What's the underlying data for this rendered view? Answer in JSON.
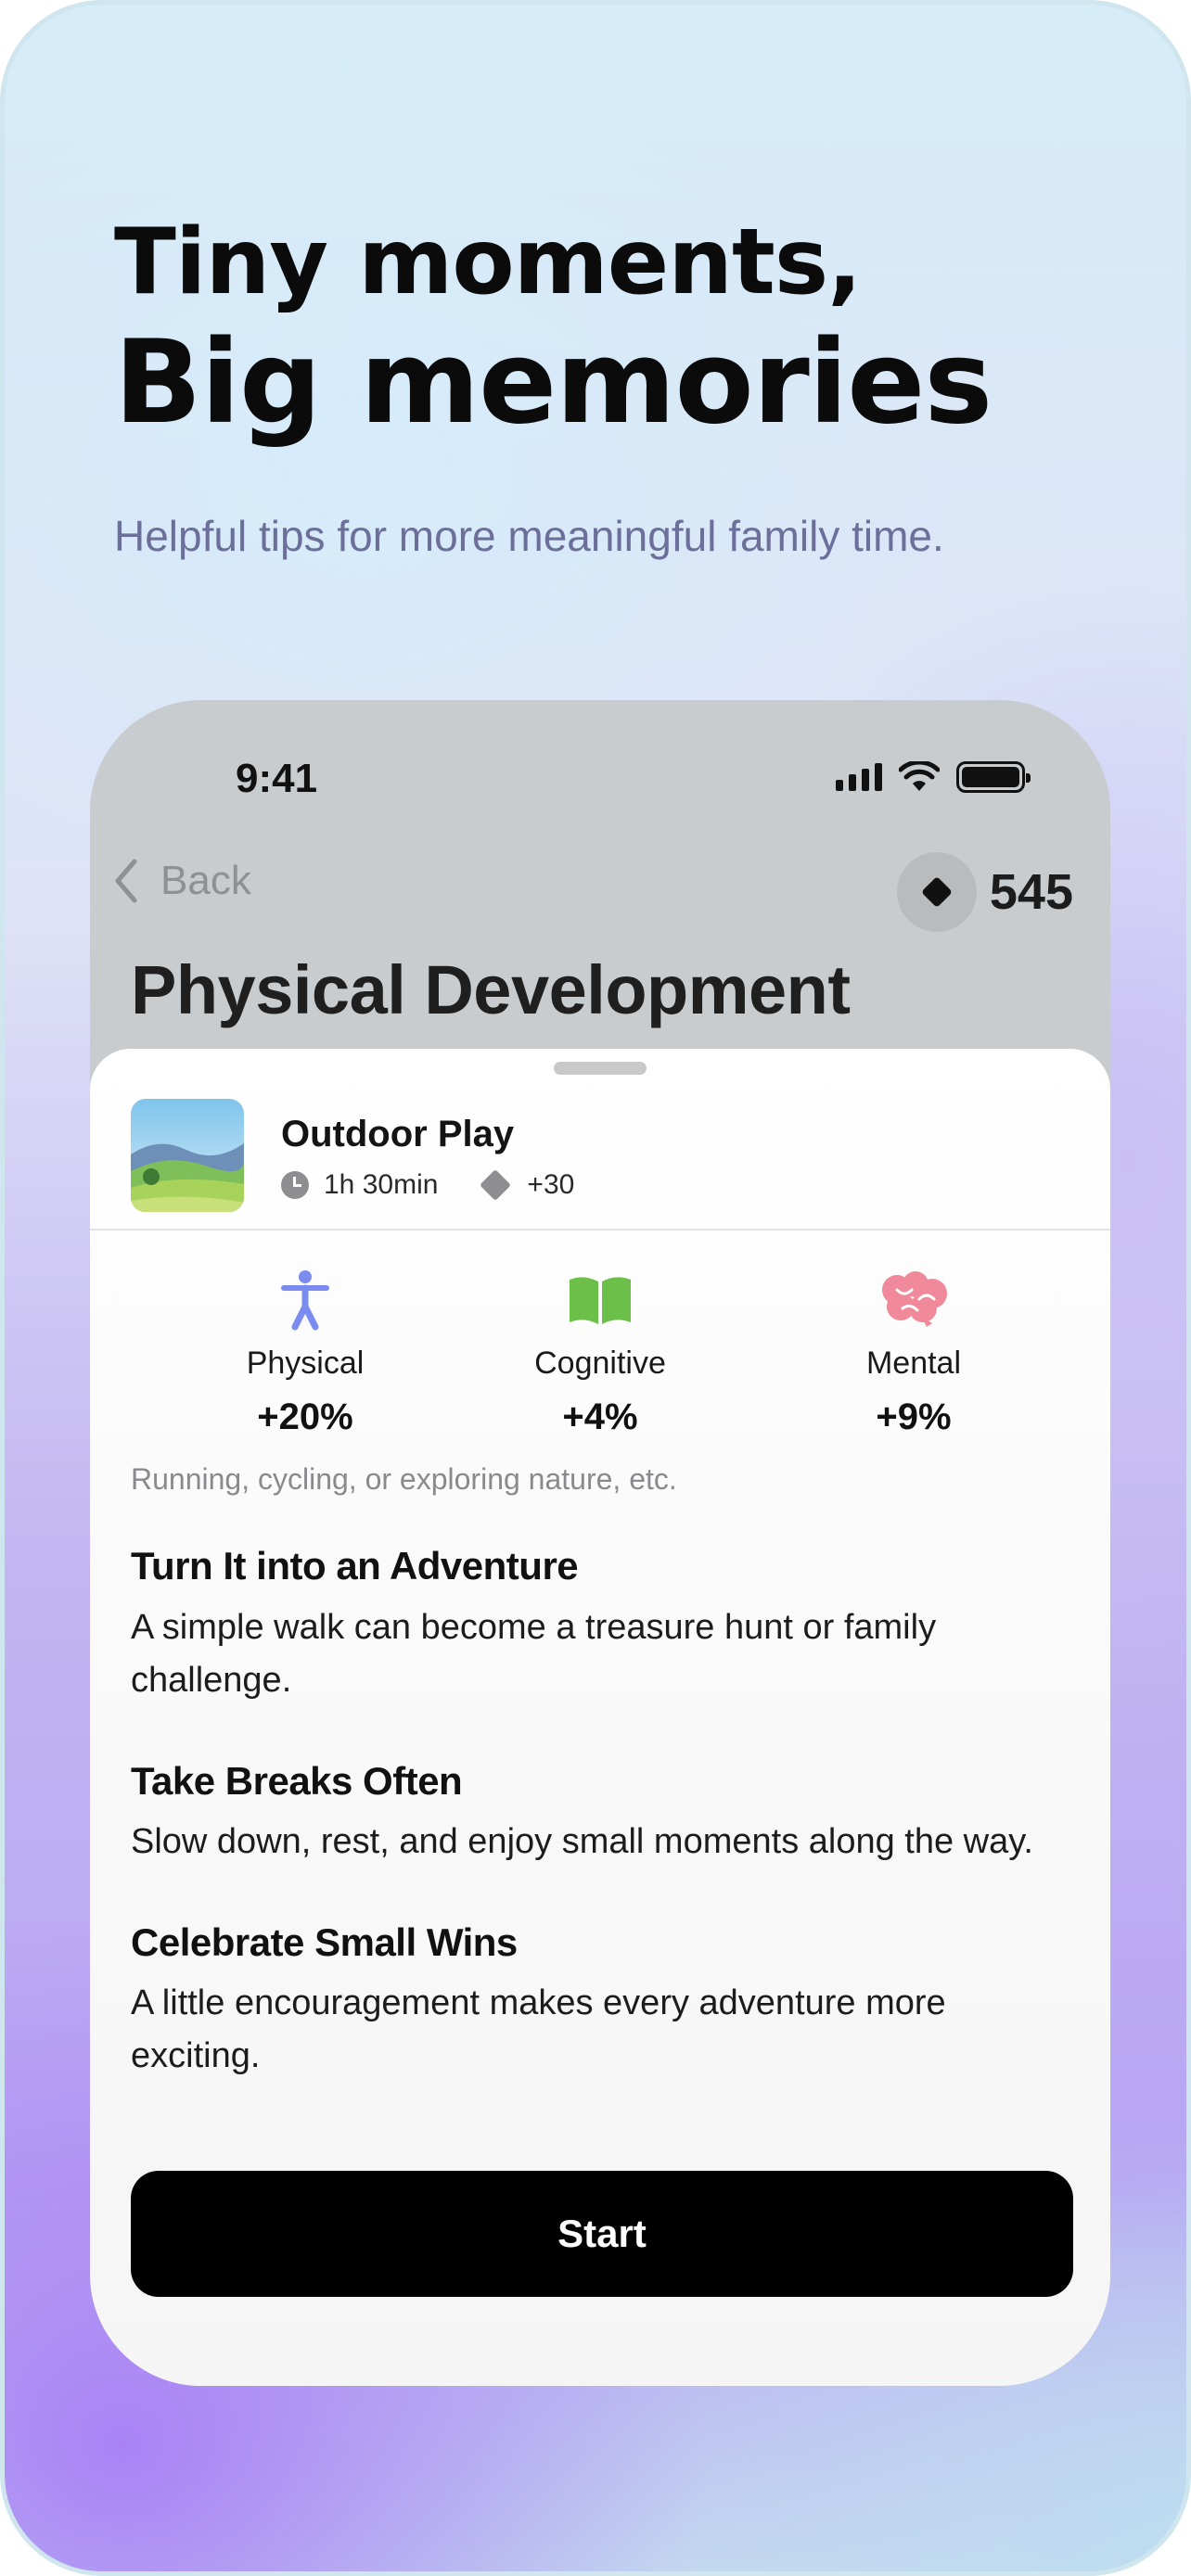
{
  "hero": {
    "line1": "Tiny moments,",
    "line2": "Big memories",
    "subtitle": "Helpful tips for more meaningful family time."
  },
  "status_bar": {
    "time": "9:41",
    "icons": [
      "cellular-signal-icon",
      "wifi-icon",
      "battery-icon"
    ]
  },
  "nav": {
    "back_label": "Back",
    "coin_icon": "diamond-icon",
    "coin_count": "545"
  },
  "page": {
    "title": "Physical Development"
  },
  "activity": {
    "name": "Outdoor Play",
    "duration": "1h 30min",
    "reward": "+30",
    "thumbnail": "landscape-hills-image"
  },
  "stats": [
    {
      "label": "Physical",
      "value": "+20%",
      "icon": "accessibility-person-icon",
      "color": "#7b8cf0"
    },
    {
      "label": "Cognitive",
      "value": "+4%",
      "icon": "open-book-icon",
      "color": "#6cc04a"
    },
    {
      "label": "Mental",
      "value": "+9%",
      "icon": "brain-icon",
      "color": "#f08a9a"
    }
  ],
  "description": "Running, cycling, or exploring nature, etc.",
  "tips": [
    {
      "title": "Turn It into an Adventure",
      "body": "A simple walk can become a treasure hunt or family challenge."
    },
    {
      "title": "Take Breaks Often",
      "body": "Slow down, rest, and enjoy small moments along the way."
    },
    {
      "title": "Celebrate Small Wins",
      "body": "A little encouragement makes every adventure more exciting."
    }
  ],
  "actions": {
    "start_label": "Start"
  },
  "colors": {
    "accent_dark": "#000000",
    "subtitle": "#6b6f9a",
    "muted": "#8a8a8e"
  }
}
